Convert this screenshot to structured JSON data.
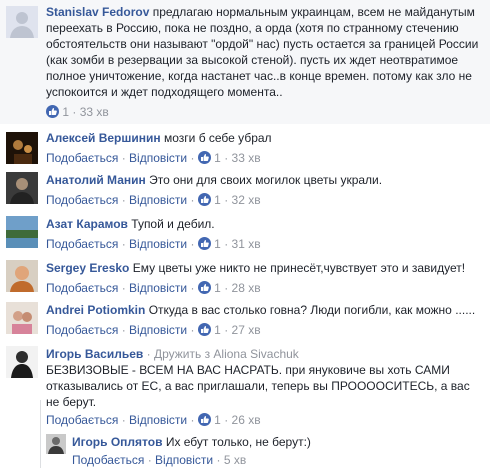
{
  "comments": [
    {
      "author": "Stanislav Fedorov",
      "text": "предлагаю нормальным украинцам, всем не майданутым переехать в Россию, пока не поздно, а орда (хотя по странному стечению обстоятельств они называют \"ордой\" нас) пусть остается за границей России (как зомби в резервации за высокой стеной). пусть их ждет неотвратимое полное уничтожение, когда настанет час..в конце времен. потому как зло не успокоится и ждет подходящего момента..",
      "likes": "1",
      "time": "33 хв"
    },
    {
      "author": "Алексей Вершинин",
      "text": "мозги б себе убрал",
      "like_label": "Подобається",
      "reply_label": "Відповісти",
      "likes": "1",
      "time": "33 хв"
    },
    {
      "author": "Анатолий Манин",
      "text": "Это они для своих могилок цветы украли.",
      "like_label": "Подобається",
      "reply_label": "Відповісти",
      "likes": "1",
      "time": "32 хв"
    },
    {
      "author": "Азат Карамов",
      "text": "Тупой и дебил.",
      "like_label": "Подобається",
      "reply_label": "Відповісти",
      "likes": "1",
      "time": "31 хв"
    },
    {
      "author": "Sergey Eresko",
      "text": "Ему цветы уже никто не принесёт,чувствует это и завидует!",
      "like_label": "Подобається",
      "reply_label": "Відповісти",
      "likes": "1",
      "time": "28 хв"
    },
    {
      "author": "Andrei Potiomkin",
      "text": "Откуда в вас столько говна? Люди погибли, как можно ......",
      "like_label": "Подобається",
      "reply_label": "Відповісти",
      "likes": "1",
      "time": "27 хв"
    },
    {
      "author": "Игорь Васильев",
      "friend_note": "· Дружить з Aliona Sivachuk",
      "text": "БЕЗВИЗОВЫЕ - ВСЕМ НА ВАС НАСРАТЬ. при януковиче вы хоть САМИ отказывались от ЕС, а вас приглашали, теперь вы ПРООООСИТЕСЬ, а вас не берут.",
      "like_label": "Подобається",
      "reply_label": "Відповісти",
      "likes": "1",
      "time": "26 хв"
    },
    {
      "author": "Игорь Оплятов",
      "text": "Их ебут только, не берут:)",
      "like_label": "Подобається",
      "reply_label": "Відповісти",
      "time": "5 хв"
    }
  ],
  "colors": {
    "link": "#365899",
    "meta": "#90949c",
    "like_badge": "#4267b2",
    "top_background": "#f6f7f9"
  }
}
